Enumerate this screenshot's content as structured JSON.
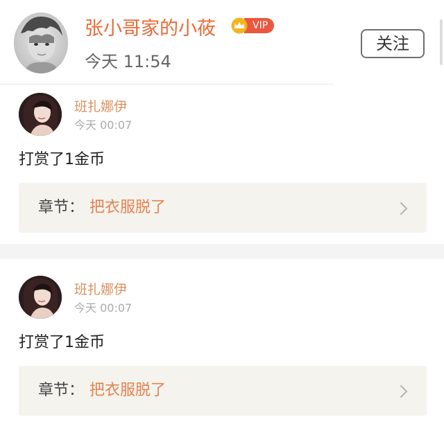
{
  "header": {
    "author_name": "张小哥家的小莜",
    "vip_label": "VIP",
    "time": "今天 11:54",
    "follow_label": "关注"
  },
  "entries": [
    {
      "username": "班扎娜伊",
      "time": "今天 00:07",
      "message": "打赏了1金币",
      "chapter_prefix": "章节：",
      "chapter_title": "把衣服脱了"
    },
    {
      "username": "班扎娜伊",
      "time": "今天 00:07",
      "message": "打赏了1金币",
      "chapter_prefix": "章节：",
      "chapter_title": "把衣服脱了"
    }
  ],
  "colors": {
    "name_orange": "#ea6a38",
    "username_orange": "#d9915f",
    "chapter_orange": "#e2834e",
    "vip_red": "#e9573f",
    "card_bg": "#f5f3ee"
  },
  "icons": [
    "vip-crown-icon",
    "chevron-right-icon"
  ]
}
